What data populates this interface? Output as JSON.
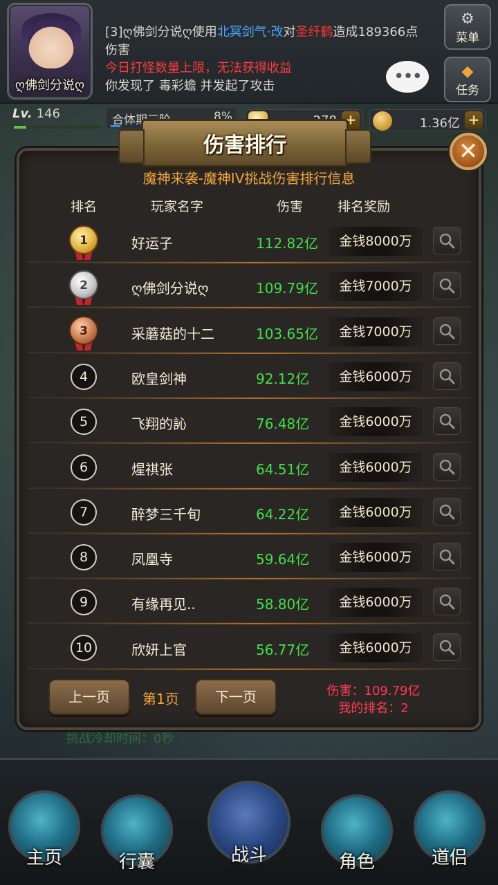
{
  "player": {
    "name": "ღ佛剑分说ღ",
    "level_label": "Lv.",
    "level": "146",
    "realm": "合体期三阶",
    "realm_pct": "8%",
    "currency1": "278",
    "currency2": "1.36亿"
  },
  "chat": {
    "line1_prefix": "[3]ღ佛剑分说ღ使用",
    "line1_skill": "北冥剑气·改",
    "line1_mid": "对",
    "line1_enemy": "圣纤鹤",
    "line1_suffix": "造成189366点伤害",
    "line2": "今日打怪数量上限，无法获得收益",
    "line3": "你发现了 毒彩蟾 并发起了攻击"
  },
  "side_buttons": {
    "menu": "菜单",
    "task": "任务"
  },
  "panel": {
    "title": "伤害排行",
    "subtitle": "魔神来袭-魔神IV挑战伤害排行信息",
    "headers": {
      "rank": "排名",
      "player": "玩家名字",
      "damage": "伤害",
      "reward": "排名奖励"
    },
    "rows": [
      {
        "rank": "1",
        "player": "好运子",
        "damage": "112.82亿",
        "reward": "金钱8000万"
      },
      {
        "rank": "2",
        "player": "ღ佛剑分说ღ",
        "damage": "109.79亿",
        "reward": "金钱7000万"
      },
      {
        "rank": "3",
        "player": "采蘑菇的十二",
        "damage": "103.65亿",
        "reward": "金钱7000万"
      },
      {
        "rank": "4",
        "player": "欧皇剑神",
        "damage": "92.12亿",
        "reward": "金钱6000万"
      },
      {
        "rank": "5",
        "player": "飞翔的訫",
        "damage": "76.48亿",
        "reward": "金钱6000万"
      },
      {
        "rank": "6",
        "player": "煋祺张",
        "damage": "64.51亿",
        "reward": "金钱6000万"
      },
      {
        "rank": "7",
        "player": "醉梦三千旬",
        "damage": "64.22亿",
        "reward": "金钱6000万"
      },
      {
        "rank": "8",
        "player": "凤凰寺",
        "damage": "59.64亿",
        "reward": "金钱6000万"
      },
      {
        "rank": "9",
        "player": "有缘再见..",
        "damage": "58.80亿",
        "reward": "金钱6000万"
      },
      {
        "rank": "10",
        "player": "欣妍上官",
        "damage": "56.77亿",
        "reward": "金钱6000万"
      }
    ],
    "prev_label": "上一页",
    "page_label": "第1页",
    "next_label": "下一页",
    "my_damage": "伤害：109.79亿",
    "my_rank": "我的排名：2"
  },
  "cooldown_text": "挑战冷却时间：0秒",
  "nav": {
    "home": "主页",
    "bag": "行囊",
    "battle": "战斗",
    "role": "角色",
    "companion": "道侣"
  },
  "colors": {
    "damage_green": "#3fe04a",
    "accent_orange": "#f4a63a",
    "my_info_red": "#ff3b52"
  }
}
